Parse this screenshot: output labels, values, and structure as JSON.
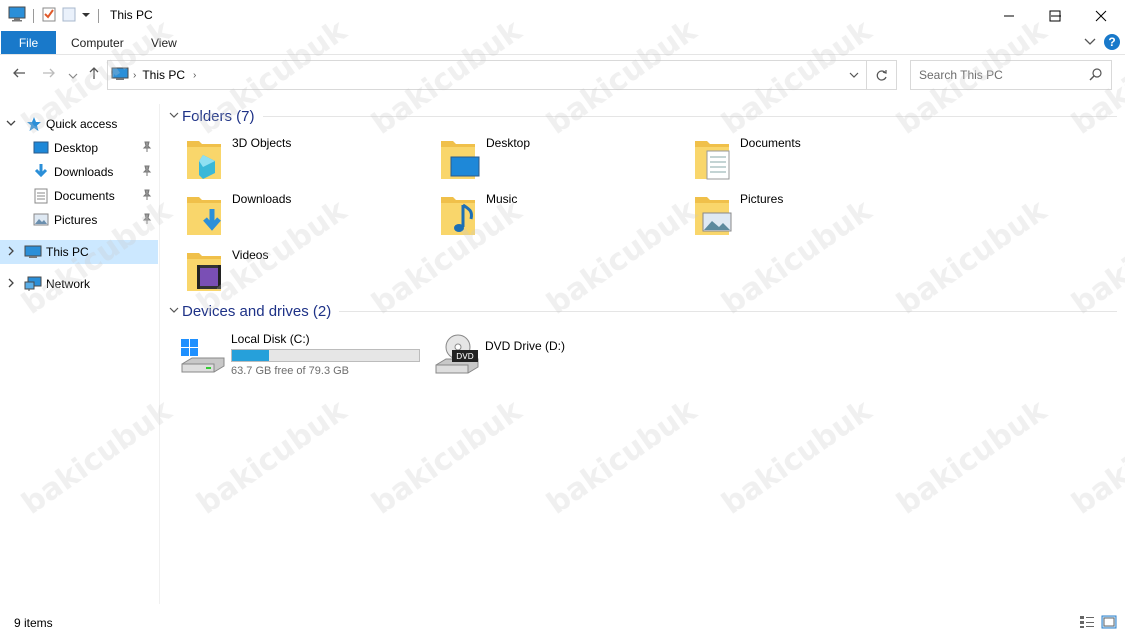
{
  "window": {
    "title": "This PC",
    "minimize_icon": "minimize-icon",
    "maximize_icon": "maximize-icon",
    "close_icon": "close-icon"
  },
  "ribbon": {
    "tabs": [
      {
        "label": "File",
        "active": true
      },
      {
        "label": "Computer"
      },
      {
        "label": "View"
      }
    ],
    "accent": "#1979ca"
  },
  "nav": {
    "breadcrumb": "This PC",
    "search_placeholder": "Search This PC"
  },
  "sidebar": {
    "items": [
      {
        "label": "Quick access",
        "icon": "star-icon"
      },
      {
        "label": "Desktop",
        "icon": "desktop-icon",
        "pinned": true
      },
      {
        "label": "Downloads",
        "icon": "download-arrow-icon",
        "pinned": true
      },
      {
        "label": "Documents",
        "icon": "document-icon",
        "pinned": true
      },
      {
        "label": "Pictures",
        "icon": "pictures-icon",
        "pinned": true
      },
      {
        "label": "This PC",
        "icon": "computer-icon",
        "selected": true
      },
      {
        "label": "Network",
        "icon": "network-icon"
      }
    ]
  },
  "folders": {
    "title": "Folders (7)",
    "items": [
      {
        "label": "3D Objects",
        "icon": "3d-objects-folder-icon"
      },
      {
        "label": "Desktop",
        "icon": "desktop-folder-icon"
      },
      {
        "label": "Documents",
        "icon": "documents-folder-icon"
      },
      {
        "label": "Downloads",
        "icon": "downloads-folder-icon"
      },
      {
        "label": "Music",
        "icon": "music-folder-icon"
      },
      {
        "label": "Pictures",
        "icon": "pictures-folder-icon"
      },
      {
        "label": "Videos",
        "icon": "videos-folder-icon"
      }
    ]
  },
  "drives": {
    "title": "Devices and drives (2)",
    "items": [
      {
        "label": "Local Disk (C:)",
        "free": "63.7 GB free of 79.3 GB",
        "used_fraction": 0.197,
        "icon": "windows-drive-icon"
      },
      {
        "label": "DVD Drive (D:)",
        "icon": "dvd-drive-icon",
        "badge": "DVD"
      }
    ]
  },
  "status": {
    "count": "9 items"
  },
  "watermark": "bakicubuk"
}
